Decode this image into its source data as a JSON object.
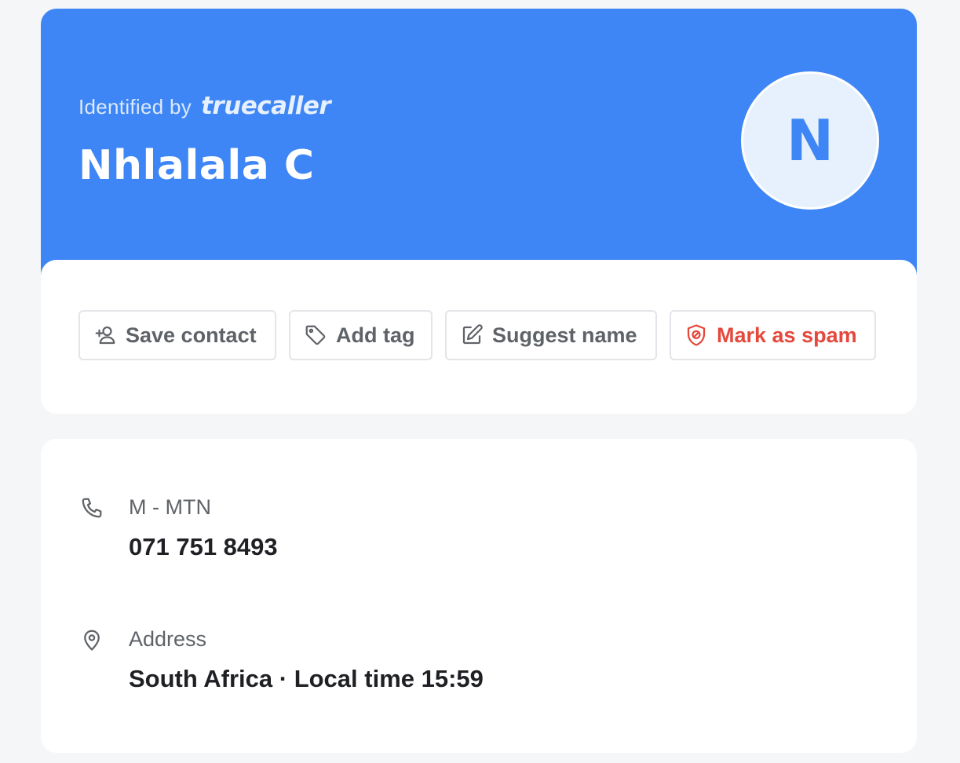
{
  "header": {
    "identified_prefix": "Identified by",
    "brand": "truecaller",
    "name": "Nhlalala C",
    "avatar_letter": "N"
  },
  "actions": {
    "save_contact": "Save contact",
    "add_tag": "Add tag",
    "suggest_name": "Suggest name",
    "mark_spam": "Mark as spam"
  },
  "details": {
    "phone": {
      "label": "M - MTN",
      "value": "071 751 8493",
      "icon": "phone-icon"
    },
    "address": {
      "label": "Address",
      "value": "South Africa · Local time 15:59",
      "icon": "location-pin-icon"
    }
  },
  "colors": {
    "header_bg": "#3e86f5",
    "avatar_bg": "#e6f1fd",
    "spam_red": "#e5483c",
    "page_bg": "#f5f6f8"
  }
}
